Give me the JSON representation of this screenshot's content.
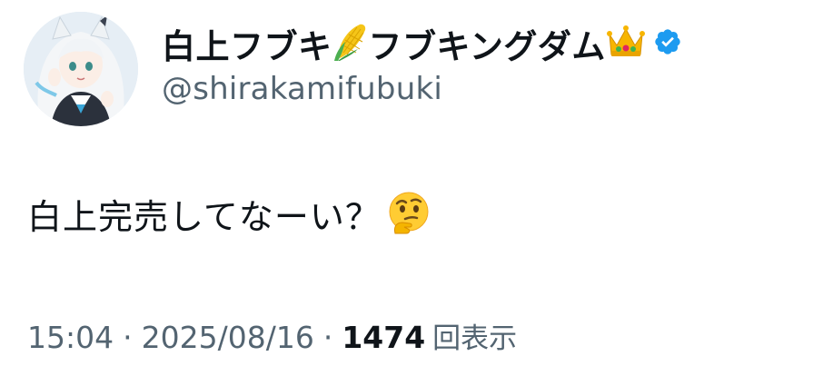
{
  "author": {
    "display_name_part1": "白上フブキ",
    "display_name_part2": "フブキングダム",
    "handle": "@shirakamifubuki",
    "name_emojis": [
      "corn-emoji",
      "crown-emoji"
    ],
    "verified": true,
    "verified_color": "#1d9bf0"
  },
  "tweet": {
    "text": "白上完売してなーい？",
    "trailing_emoji": "thinking-face-emoji"
  },
  "meta": {
    "time": "15:04",
    "separator": "·",
    "date": "2025/08/16",
    "views_count": "1474",
    "views_label": "回表示"
  },
  "colors": {
    "text_primary": "#0f1419",
    "text_secondary": "#536471",
    "background": "#ffffff"
  }
}
